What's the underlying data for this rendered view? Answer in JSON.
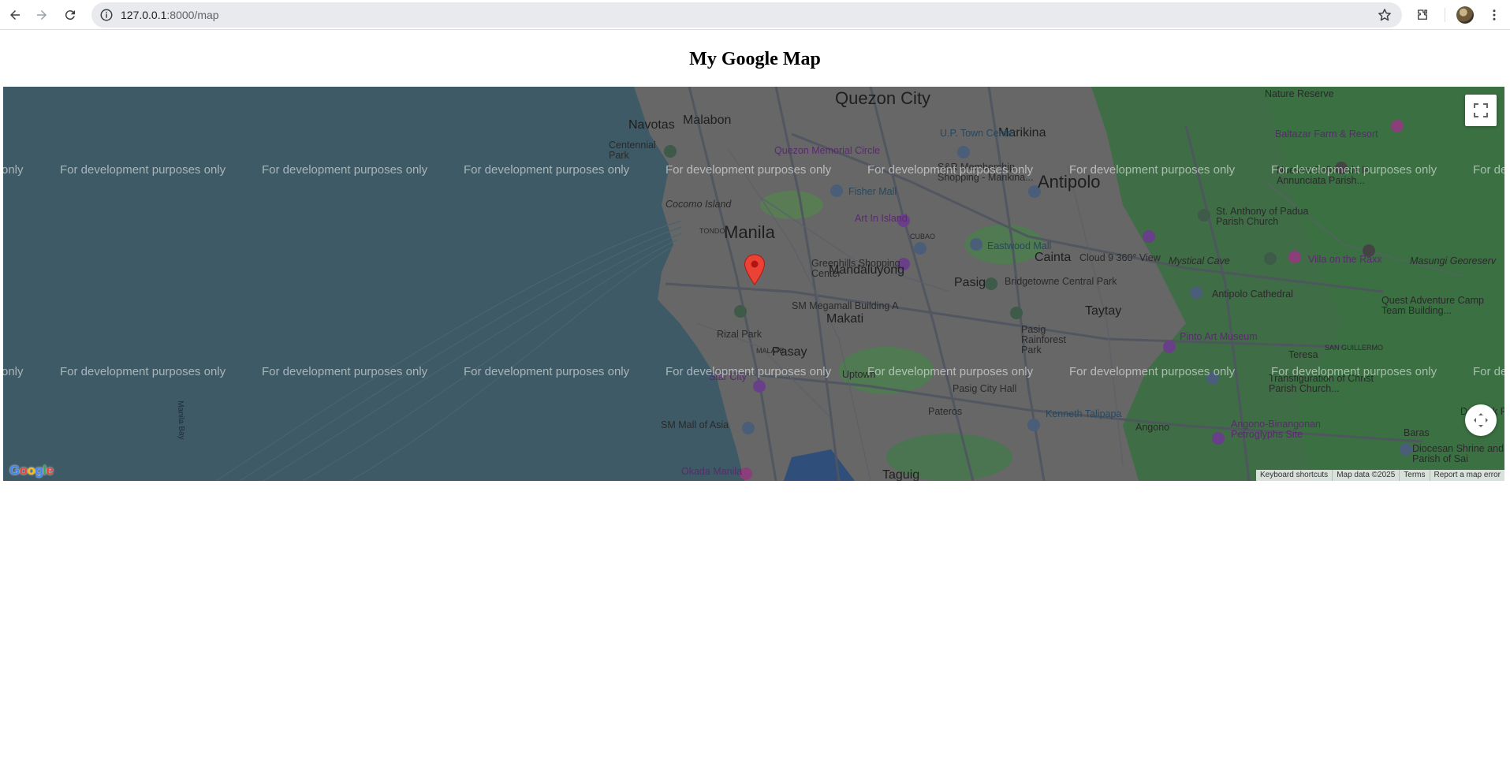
{
  "browser": {
    "url_host": "127.0.0.1",
    "url_rest": ":8000/map"
  },
  "page": {
    "title": "My Google Map"
  },
  "map": {
    "watermark": "For development purposes only",
    "watermark_edge_left": "only",
    "watermark_edge_right": "For de",
    "labels": {
      "quezon_city": "Quezon City",
      "manila": "Manila",
      "antipolo": "Antipolo",
      "mandaluyong": "Mandaluyong",
      "makati": "Makati",
      "pasay": "Pasay",
      "taytay": "Taytay",
      "cainta": "Cainta",
      "pasig": "Pasig",
      "marikina": "Marikina",
      "navotas": "Navotas",
      "malabon": "Malabon",
      "pateros": "Pateros",
      "angono": "Angono",
      "baras": "Baras",
      "teresa": "Teresa",
      "taguig": "Taguig",
      "cocomo_island": "Cocomo Island",
      "tondo": "TONDO",
      "malate": "MALATE",
      "cubao": "CUBAO",
      "san_guillermo": "SAN GUILLERMO",
      "centennial_park": "Centennial Park",
      "rizal_park": "Rizal Park",
      "greenhills": "Greenhills Shopping Center",
      "sm_megamall": "SM Megamall Building A",
      "sm_mall_of_asia": "SM Mall of Asia",
      "okada": "Okada Manila",
      "star_city": "Star City",
      "fisher_mall": "Fisher Mall",
      "art_in_island": "Art In Island",
      "eastwood": "Eastwood Mall",
      "cloud9": "Cloud 9 360° View",
      "mystical_cave": "Mystical Cave",
      "villa_raxx": "Villa on the Raxx",
      "bridgetowne": "Bridgetowne Central Park",
      "antipolo_cathedral": "Antipolo Cathedral",
      "pinto": "Pinto Art Museum",
      "pasig_rainforest": "Pasig Rainforest Park",
      "pasig_city_hall": "Pasig City Hall",
      "kenneth": "Kenneth Talipapa",
      "angono_petroglyphs": "Angono-Binangonan Petroglyphs Site",
      "quezon_memorial": "Quezon Memorial Circle",
      "up_town": "U.P. Town Center",
      "sr_marikina": "S&R Membership Shopping - Marikina...",
      "nature_reserve": "Nature Reserve",
      "baltazar": "Baltazar Farm & Resort",
      "st_anthony": "St. Anthony of Padua Parish Church",
      "quest_adventure": "Quest Adventure Camp Team Building...",
      "transfiguration": "Transfiguration of Christ Parish Church...",
      "diocesan": "Diocesan Shrine and Parish of Sai",
      "daranak": "Daranak Fa",
      "masungi": "Masungi Georeserv",
      "uptown": "Uptown",
      "manila_bay": "Manila Bay",
      "nuestra": "Nuestra Señora de la Annunciata Parish..."
    },
    "google_logo": "Google",
    "attribution": [
      "Keyboard shortcuts",
      "Map data ©2025",
      "Terms",
      "Report a map error"
    ]
  },
  "colors": {
    "water": "#3d5a66",
    "land": "#6b6b6b",
    "green": "#3f7a4a",
    "marker": "#ea4335"
  },
  "icons": [
    "back-arrow-icon",
    "forward-arrow-icon",
    "reload-icon",
    "site-info-icon",
    "bookmark-star-icon",
    "extensions-icon",
    "profile-avatar",
    "more-menu-icon",
    "fullscreen-icon",
    "camera-control-icon",
    "map-marker-icon"
  ]
}
